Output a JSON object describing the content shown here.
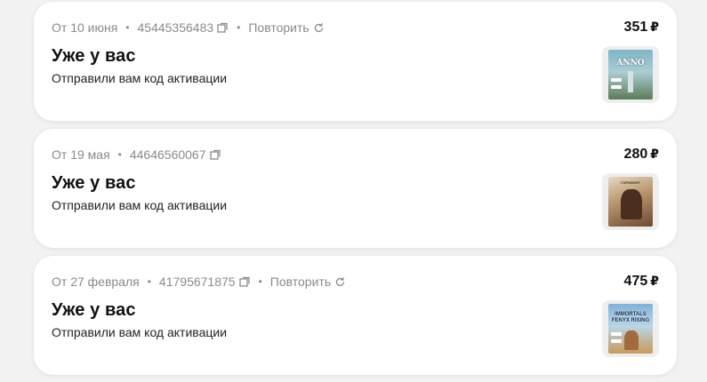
{
  "orders": [
    {
      "date": "От 10 июня",
      "number": "45445356483",
      "repeat_label": "Повторить",
      "status_title": "Уже у вас",
      "status_desc": "Отправили вам код активации",
      "price": "351",
      "currency": "₽",
      "cover_title": "ANNO"
    },
    {
      "date": "От 19 мая",
      "number": "44646560067",
      "status_title": "Уже у вас",
      "status_desc": "Отправили вам код активации",
      "price": "280",
      "currency": "₽",
      "cover_title": "ГОРИЗОНТ"
    },
    {
      "date": "От 27 февраля",
      "number": "41795671875",
      "repeat_label": "Повторить",
      "status_title": "Уже у вас",
      "status_desc": "Отправили вам код активации",
      "price": "475",
      "currency": "₽",
      "cover_title": "IMMORTALS FENYX RISING"
    }
  ],
  "icons": {
    "copy": "copy-icon",
    "repeat": "refresh-icon"
  },
  "colors": {
    "background": "#f2f2f2",
    "card": "#ffffff",
    "muted_text": "#8a8a8a",
    "primary_text": "#111111"
  }
}
